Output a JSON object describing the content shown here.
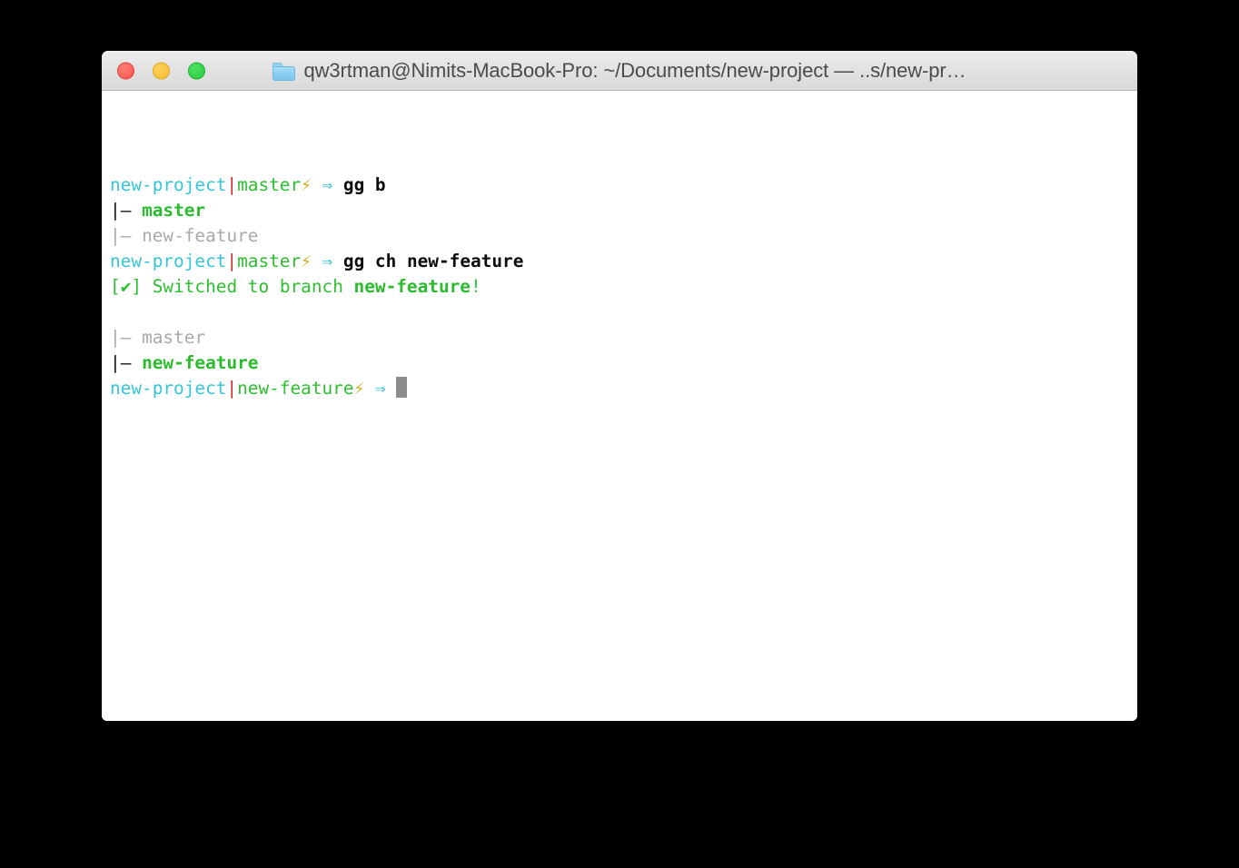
{
  "window": {
    "title": "qw3rtman@Nimits-MacBook-Pro: ~/Documents/new-project — ..s/new-pr…",
    "folder_icon": "folder-icon",
    "controls": {
      "close_label": "",
      "minimize_label": "",
      "maximize_label": ""
    }
  },
  "colors": {
    "prompt_dir": "#36c5d8",
    "prompt_separator": "#c92c2c",
    "prompt_branch": "#2dbf30",
    "prompt_bolt": "#c9b21e",
    "prompt_arrow": "#39c3d6",
    "command_text": "#131313",
    "branch_active": "#2cbb2f",
    "branch_inactive": "#a9a9a9",
    "success_text": "#2dbf30",
    "cursor": "#8c8c8c",
    "titlebar_bg": "#e3e3e3",
    "title_text": "#4b4b4e",
    "terminal_bg": "#ffffff"
  },
  "terminal": {
    "lines": [
      {
        "id": "prompt-line-1",
        "type": "prompt",
        "dir": "new-project",
        "separator": "|",
        "branch": "master",
        "bolt": "⚡",
        "arrow": "⇒",
        "command": "gg b"
      },
      {
        "id": "branch-item-master-1",
        "type": "branch",
        "marker_pipe": "|",
        "marker_dash": "–",
        "name": "master",
        "active": true
      },
      {
        "id": "branch-item-new-feature-1",
        "type": "branch",
        "marker_pipe": "|",
        "marker_dash": "–",
        "name": "new-feature",
        "active": false
      },
      {
        "id": "prompt-line-2",
        "type": "prompt",
        "dir": "new-project",
        "separator": "|",
        "branch": "master",
        "bolt": "⚡",
        "arrow": "⇒",
        "command": "gg ch new-feature"
      },
      {
        "id": "status-line",
        "type": "status",
        "bracket_open": "[",
        "check": "✔",
        "bracket_close": "]",
        "message_prefix": " Switched to branch ",
        "highlight": "new-feature",
        "message_suffix": "!"
      },
      {
        "id": "blank-line-1",
        "type": "blank"
      },
      {
        "id": "branch-item-master-2",
        "type": "branch",
        "marker_pipe": "|",
        "marker_dash": "–",
        "name": "master",
        "active": false
      },
      {
        "id": "branch-item-new-feature-2",
        "type": "branch",
        "marker_pipe": "|",
        "marker_dash": "–",
        "name": "new-feature",
        "active": true
      },
      {
        "id": "prompt-line-3",
        "type": "prompt-cursor",
        "dir": "new-project",
        "separator": "|",
        "branch": "new-feature",
        "bolt": "⚡",
        "arrow": "⇒",
        "command": ""
      }
    ]
  }
}
